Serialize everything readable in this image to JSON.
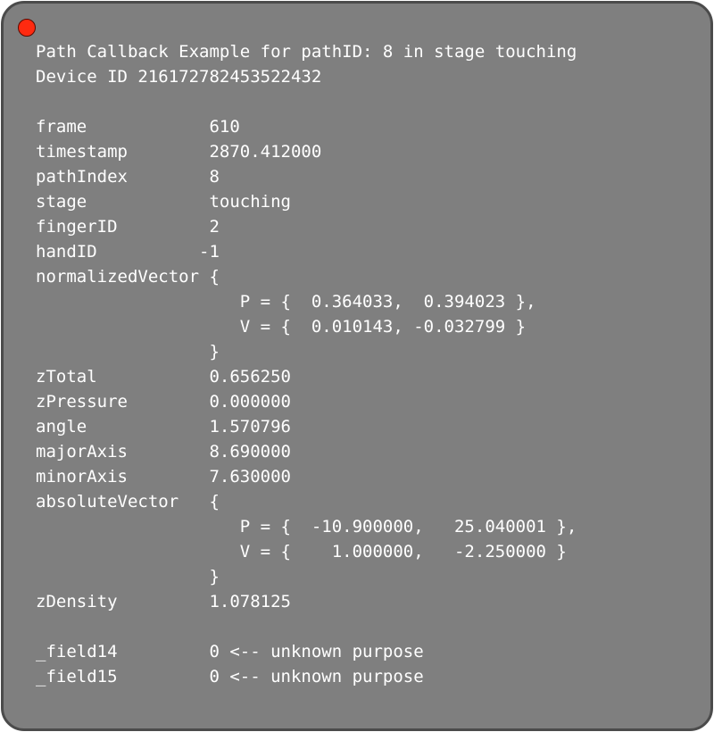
{
  "window": {
    "close_icon": "close-dot-icon",
    "close_color": "#ff2a10",
    "background_color": "#7f7f7f"
  },
  "header": {
    "title": "Path Callback Example for pathID: 8 in stage touching",
    "device": "Device ID 216172782453522432"
  },
  "fields": {
    "frame": "frame            610",
    "timestamp": "timestamp        2870.412000",
    "pathIndex": "pathIndex        8",
    "stage": "stage            touching",
    "fingerID": "fingerID         2",
    "handID": "handID          -1",
    "normalizedVector_open": "normalizedVector {",
    "normalizedVector_P": "                    P = {  0.364033,  0.394023 },",
    "normalizedVector_V": "                    V = {  0.010143, -0.032799 }",
    "normalizedVector_close": "                 }",
    "zTotal": "zTotal           0.656250",
    "zPressure": "zPressure        0.000000",
    "angle": "angle            1.570796",
    "majorAxis": "majorAxis        8.690000",
    "minorAxis": "minorAxis        7.630000",
    "absoluteVector_open": "absoluteVector   {",
    "absoluteVector_P": "                    P = {  -10.900000,   25.040001 },",
    "absoluteVector_V": "                    V = {    1.000000,   -2.250000 }",
    "absoluteVector_close": "                 }",
    "zDensity": "zDensity         1.078125",
    "field14": "_field14         0 <-- unknown purpose",
    "field15": "_field15         0 <-- unknown purpose"
  }
}
